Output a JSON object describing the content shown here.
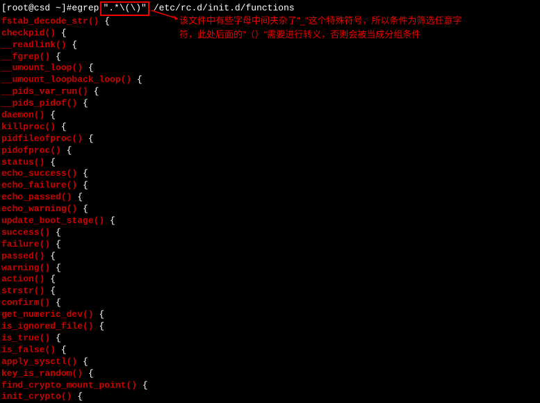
{
  "prompt": "[root@csd ~]# ",
  "command": "egrep ",
  "pattern": "\".*\\(\\)\"",
  "filepath": "/etc/rc.d/init.d/functions",
  "annotation_line1": "该文件中有些字母中间夹杂了\"_\"这个特殊符号，所以条件为筛选任意字",
  "annotation_line2": "符，此处后面的\"（）\"需要进行转义，否则会被当成分组条件",
  "output": [
    {
      "match": "fstab_decode_str()",
      "rest": " {"
    },
    {
      "match": "checkpid()",
      "rest": " {"
    },
    {
      "match": "__readlink()",
      "rest": " {"
    },
    {
      "match": "__fgrep()",
      "rest": " {"
    },
    {
      "match": "__umount_loop()",
      "rest": " {"
    },
    {
      "match": "__umount_loopback_loop()",
      "rest": " {"
    },
    {
      "match": "__pids_var_run()",
      "rest": " {"
    },
    {
      "match": "__pids_pidof()",
      "rest": " {"
    },
    {
      "match": "daemon()",
      "rest": " {"
    },
    {
      "match": "killproc()",
      "rest": " {"
    },
    {
      "match": "pidfileofproc()",
      "rest": " {"
    },
    {
      "match": "pidofproc()",
      "rest": " {"
    },
    {
      "match": "status()",
      "rest": " {"
    },
    {
      "match": "echo_success()",
      "rest": " {"
    },
    {
      "match": "echo_failure()",
      "rest": " {"
    },
    {
      "match": "echo_passed()",
      "rest": " {"
    },
    {
      "match": "echo_warning()",
      "rest": " {"
    },
    {
      "match": "update_boot_stage()",
      "rest": " {"
    },
    {
      "match": "success()",
      "rest": " {"
    },
    {
      "match": "failure()",
      "rest": " {"
    },
    {
      "match": "passed()",
      "rest": " {"
    },
    {
      "match": "warning()",
      "rest": " {"
    },
    {
      "match": "action()",
      "rest": " {"
    },
    {
      "match": "strstr()",
      "rest": " {"
    },
    {
      "match": "confirm()",
      "rest": " {"
    },
    {
      "match": "get_numeric_dev()",
      "rest": " {"
    },
    {
      "match": "is_ignored_file()",
      "rest": " {"
    },
    {
      "match": "is_true()",
      "rest": " {"
    },
    {
      "match": "is_false()",
      "rest": " {"
    },
    {
      "match": "apply_sysctl()",
      "rest": " {"
    },
    {
      "match": "key_is_random()",
      "rest": " {"
    },
    {
      "match": "find_crypto_mount_point()",
      "rest": " {"
    },
    {
      "match": "init_crypto()",
      "rest": " {"
    }
  ]
}
